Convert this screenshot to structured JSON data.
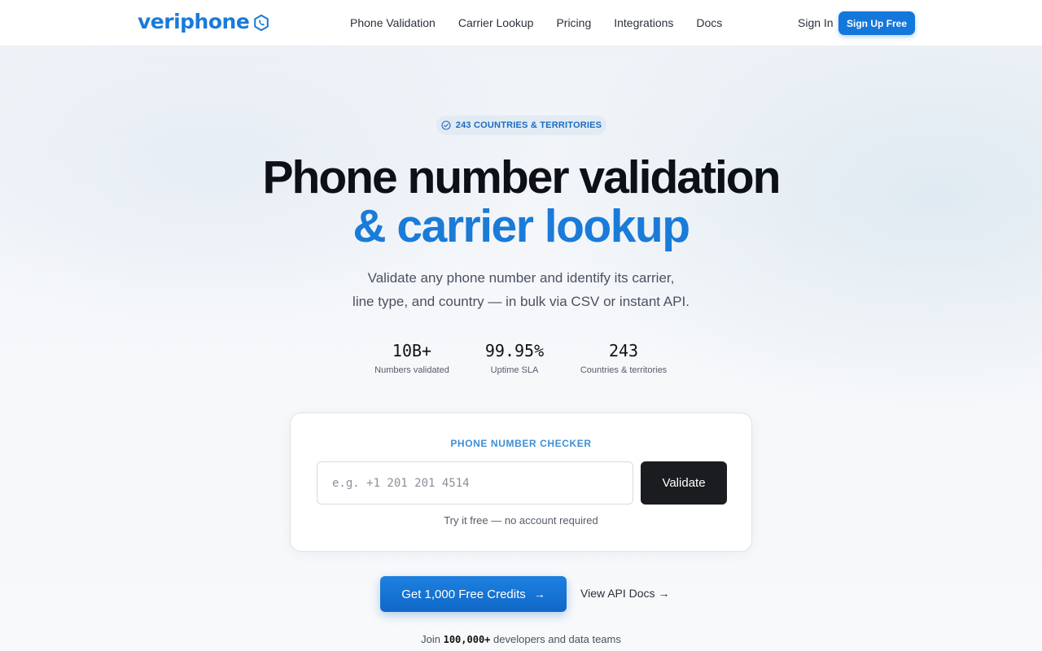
{
  "brand": {
    "name": "veriphone",
    "logo_icon": "phone-hexagon-icon",
    "accent_color": "#1a7bd8"
  },
  "nav": {
    "links": [
      "Phone Validation",
      "Carrier Lookup",
      "Pricing",
      "Integrations",
      "Docs"
    ],
    "sign_in": "Sign In",
    "sign_up": "Sign Up Free"
  },
  "hero": {
    "badge": "243 COUNTRIES & TERRITORIES",
    "badge_icon": "check-circle-icon",
    "title_line1": "Phone number validation",
    "title_line2": "& carrier lookup",
    "subtitle_line1": "Validate any phone number and identify its carrier,",
    "subtitle_line2": "line type, and country — in bulk via CSV or instant API."
  },
  "stats": [
    {
      "value": "10B+",
      "label": "Numbers validated"
    },
    {
      "value": "99.95%",
      "label": "Uptime SLA"
    },
    {
      "value": "243",
      "label": "Countries & territories"
    }
  ],
  "checker": {
    "title": "PHONE NUMBER CHECKER",
    "input_placeholder": "e.g. +1 201 201 4514",
    "input_value": "",
    "button": "Validate",
    "note": "Try it free — no account required"
  },
  "cta": {
    "primary": "Get 1,000 Free Credits",
    "primary_icon": "arrow-right-icon",
    "secondary": "View API Docs →"
  },
  "join": {
    "prefix": "Join",
    "count": "100,000+",
    "suffix": "developers and data teams"
  }
}
